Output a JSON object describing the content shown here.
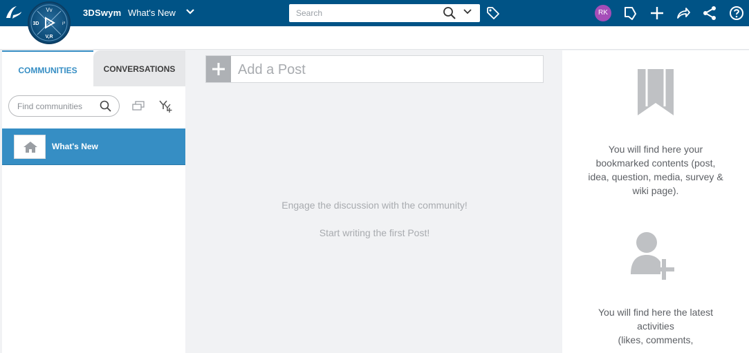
{
  "topbar": {
    "compass": {
      "top": "Vv",
      "left": "3D",
      "right": "i³",
      "bottom": "V,R"
    },
    "app_name": "3DSwym",
    "app_context": "What's New",
    "search_placeholder": "Search",
    "user_initials": "RK",
    "colors": {
      "bar": "#005386",
      "avatar": "#a54db8"
    },
    "icons": [
      "ds-logo-icon",
      "chevron-down-icon",
      "search-icon",
      "tag-icon",
      "social-icon",
      "plus-icon",
      "share-icon",
      "network-icon",
      "help-icon"
    ]
  },
  "left_panel": {
    "tabs": [
      {
        "label": "COMMUNITIES",
        "active": true
      },
      {
        "label": "CONVERSATIONS",
        "active": false
      }
    ],
    "find_placeholder": "Find communities",
    "items": [
      {
        "label": "What's New",
        "selected": true,
        "icon": "home-icon"
      }
    ],
    "accent": "#368ec4"
  },
  "center": {
    "add_post_label": "Add a Post",
    "empty_line1": "Engage the discussion with the community!",
    "empty_line2": "Start writing the first Post!"
  },
  "right_panel": {
    "bookmarks_text_lines": [
      "You will find here your",
      "bookmarked contents (post,",
      "idea, question, media, survey &",
      "wiki page)."
    ],
    "activities_text_lines": [
      "You will find here the latest",
      "activities",
      "(likes, comments,"
    ]
  }
}
